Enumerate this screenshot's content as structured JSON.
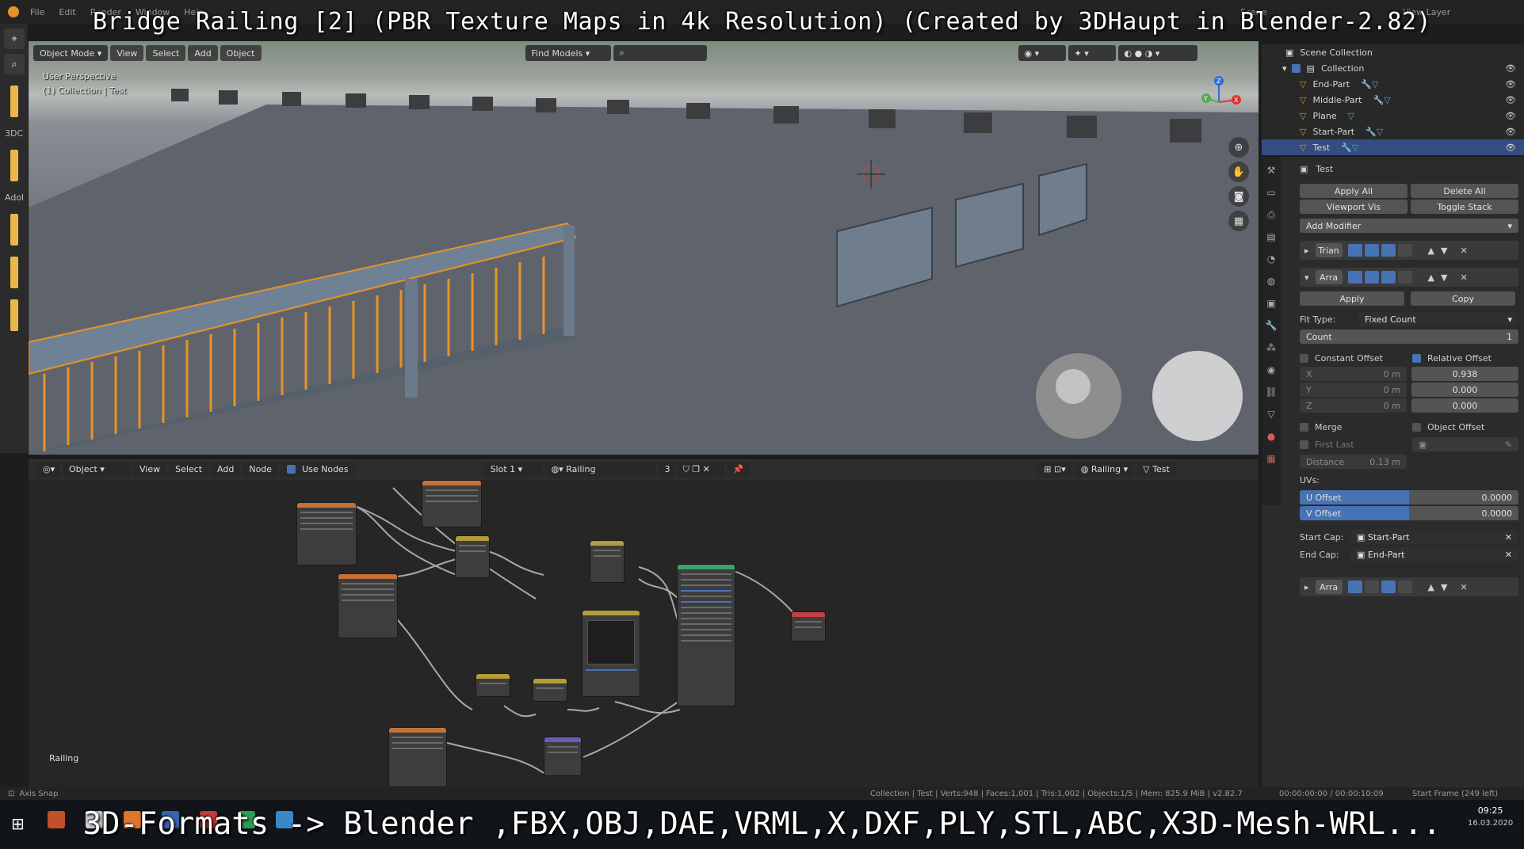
{
  "overlay": {
    "title": "Bridge Railing [2] (PBR Texture Maps in 4k Resolution) (Created by 3DHaupt in Blender-2.82)",
    "formats": "3D-Formats -> Blender ,FBX,OBJ,DAE,VRML,X,DXF,PLY,STL,ABC,X3D-Mesh-WRL..."
  },
  "menu": [
    "File",
    "Edit",
    "Render",
    "Window",
    "Help"
  ],
  "topright": {
    "scene": "Scene",
    "view_layer": "View Layer"
  },
  "left_side_labels": [
    "3DC",
    "Adol"
  ],
  "viewport": {
    "mode": "Object Mode",
    "menus": [
      "View",
      "Select",
      "Add",
      "Object"
    ],
    "find_models": "Find Models",
    "perspective": "User Perspective",
    "collection_info": "(1) Collection | Test",
    "axes": [
      "Z",
      "Y",
      "X"
    ]
  },
  "node_editor": {
    "type": "Object",
    "menus": [
      "View",
      "Select",
      "Add",
      "Node"
    ],
    "use_nodes": "Use Nodes",
    "slot": "Slot 1",
    "material": "Railing",
    "users": "3",
    "right_material": "Railing",
    "right_object": "Test",
    "frame_label": "Railing"
  },
  "outliner": {
    "root": "Scene Collection",
    "collection": "Collection",
    "items": [
      {
        "name": "End-Part",
        "selected": false
      },
      {
        "name": "Middle-Part",
        "selected": false
      },
      {
        "name": "Plane",
        "selected": false
      },
      {
        "name": "Start-Part",
        "selected": false
      },
      {
        "name": "Test",
        "selected": true
      }
    ]
  },
  "properties": {
    "object_name": "Test",
    "apply_all": "Apply All",
    "delete_all": "Delete All",
    "viewport_vis": "Viewport Vis",
    "toggle_stack": "Toggle Stack",
    "add_modifier": "Add Modifier",
    "modifiers": [
      "Trian",
      "Arra",
      "Arra"
    ],
    "apply": "Apply",
    "copy": "Copy",
    "fit_type_label": "Fit Type:",
    "fit_type": "Fixed Count",
    "count_label": "Count",
    "count": "1",
    "constant_offset": "Constant Offset",
    "relative_offset": "Relative Offset",
    "constant": {
      "x_label": "X",
      "x": "0 m",
      "y_label": "Y",
      "y": "0 m",
      "z_label": "Z",
      "z": "0 m"
    },
    "relative": {
      "x": "0.938",
      "y": "0.000",
      "z": "0.000"
    },
    "merge": "Merge",
    "object_offset": "Object Offset",
    "first_last": "First Last",
    "distance_label": "Distance",
    "distance": "0.13 m",
    "uvs_label": "UVs:",
    "u_offset_label": "U Offset",
    "u_offset": "0.0000",
    "v_offset_label": "V Offset",
    "v_offset": "0.0000",
    "start_cap_label": "Start Cap:",
    "start_cap": "Start-Part",
    "end_cap_label": "End Cap:",
    "end_cap": "End-Part"
  },
  "status": {
    "left": "Axis Snap",
    "stats": "Collection | Test | Verts:948 | Faces:1,001 | Tris:1,002 | Objects:1/5 | Mem: 825.9 MiB | v2.82.7",
    "time": "00:00:00:00 / 00:00:10:09",
    "start_frame": "Start Frame (249 left)"
  },
  "clock": {
    "time": "09:25",
    "date": "16.03.2020"
  },
  "colors": {
    "selection_blue": "#4772b3",
    "highlight_orange": "#e8922a",
    "outliner_selected": "#334d80"
  }
}
